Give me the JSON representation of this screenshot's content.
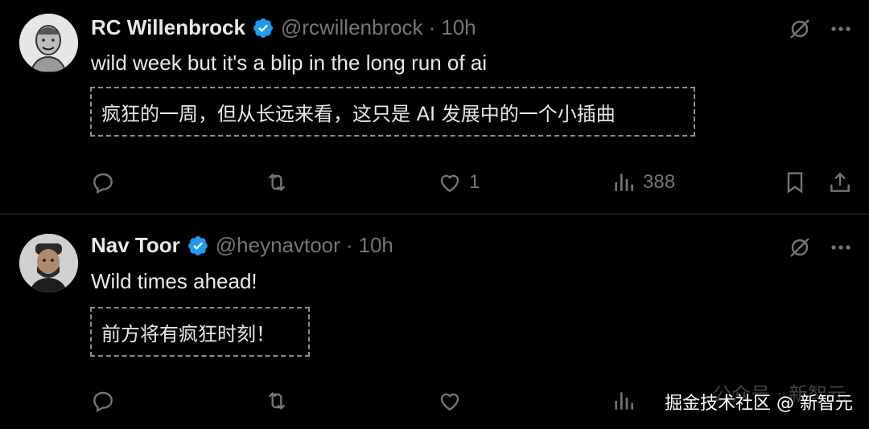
{
  "tweets": [
    {
      "name": "RC Willenbrock",
      "handle": "@rcwillenbrock",
      "dot": "·",
      "time": "10h",
      "text": "wild week but it's a blip in the long run of ai",
      "translation": "疯狂的一周，但从长远来看，这只是 AI 发展中的一个小插曲",
      "likes": "1",
      "views": "388"
    },
    {
      "name": "Nav Toor",
      "handle": "@heynavtoor",
      "dot": "·",
      "time": "10h",
      "text": "Wild times ahead!",
      "translation": "前方将有疯狂时刻！",
      "views": "",
      "likes": ""
    }
  ],
  "watermark": {
    "ghost": "公众号 · 新智元",
    "text": "掘金技术社区 @ 新智元"
  },
  "colors": {
    "background": "#000000",
    "text": "#e7e9ea",
    "muted": "#71767b",
    "verified": "#1d9bf0",
    "divider": "#2f3336"
  }
}
